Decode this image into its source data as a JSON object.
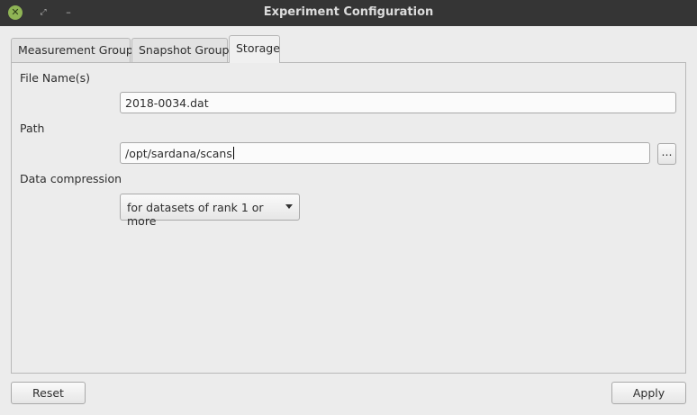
{
  "window": {
    "title": "Experiment Configuration",
    "close_glyph": "✕",
    "restore_glyph": "⤢",
    "minimize_glyph": "–"
  },
  "tabs": [
    {
      "label": "Measurement Group",
      "active": false
    },
    {
      "label": "Snapshot Group",
      "active": false
    },
    {
      "label": "Storage",
      "active": true
    }
  ],
  "storage": {
    "file_names_label": "File Name(s)",
    "file_names_value": "2018-0034.dat",
    "path_label": "Path",
    "path_value": "/opt/sardana/scans",
    "browse_label": "...",
    "compression_label": "Data compression",
    "compression_value": "for datasets of rank 1 or more"
  },
  "footer": {
    "reset_label": "Reset",
    "apply_label": "Apply"
  }
}
